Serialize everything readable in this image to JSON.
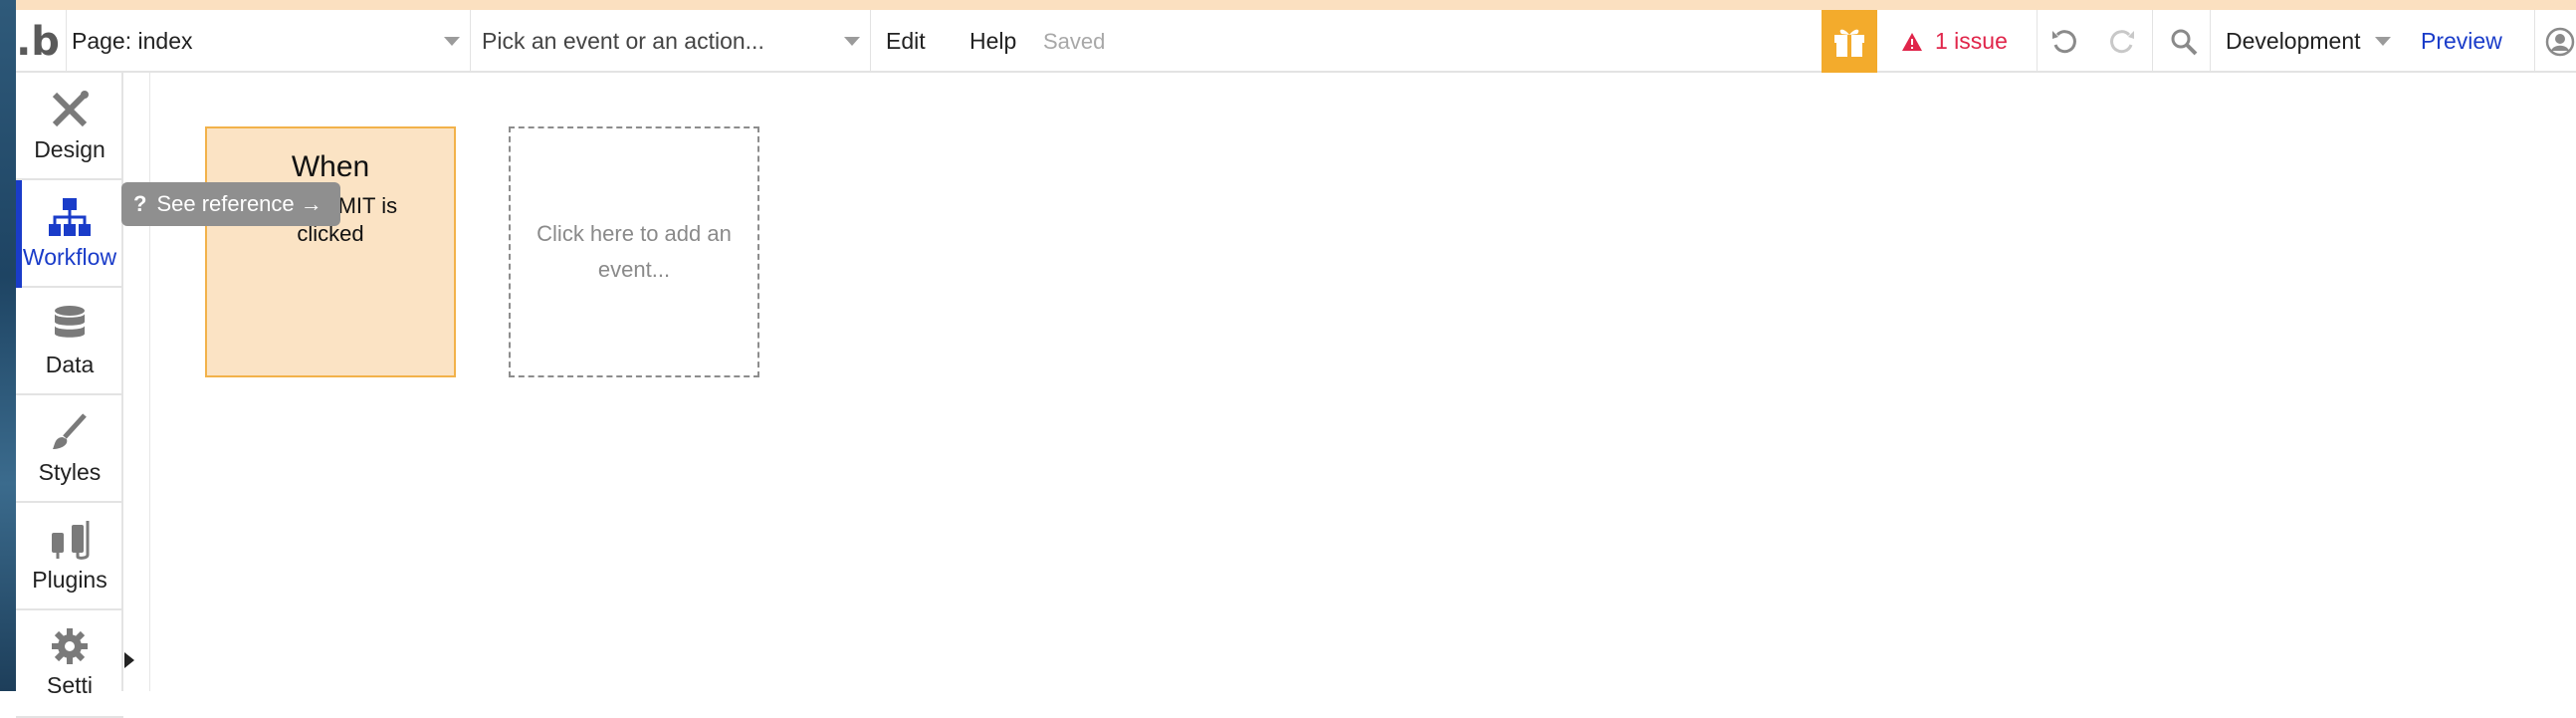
{
  "topbar": {
    "logo": ".b",
    "page_select": "Page: index",
    "event_select_placeholder": "Pick an event or an action...",
    "menu_edit": "Edit",
    "menu_help": "Help",
    "save_status": "Saved",
    "issues_label": "1 issue",
    "environment": "Development",
    "preview": "Preview"
  },
  "sidebar": {
    "items": [
      {
        "label": "Design",
        "icon": "design-icon"
      },
      {
        "label": "Workflow",
        "icon": "workflow-icon",
        "active": true
      },
      {
        "label": "Data",
        "icon": "database-icon"
      },
      {
        "label": "Styles",
        "icon": "brush-icon"
      },
      {
        "label": "Plugins",
        "icon": "plug-icon"
      },
      {
        "label": "Setti",
        "icon": "gear-icon"
      }
    ]
  },
  "canvas": {
    "event_card": {
      "title": "When",
      "desc_line1": "BMIT is",
      "desc_line2": "clicked"
    },
    "add_event": "Click here to add an event..."
  },
  "tooltip": {
    "label": "See reference →"
  },
  "colors": {
    "accent_blue": "#1a3cc9",
    "gift_orange": "#f3ab2c",
    "issue_red": "#e0254a",
    "event_card_bg": "#fbe3c4",
    "event_card_border": "#f2b24a"
  }
}
